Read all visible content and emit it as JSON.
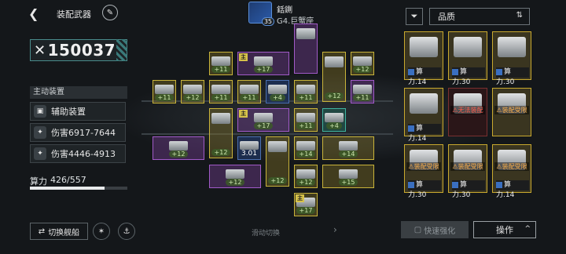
{
  "header": {
    "back_icon": "back-arrow-icon",
    "title": "装配武器",
    "edit_icon": "pencil-icon"
  },
  "ship": {
    "level": "35",
    "name": "銛鍘",
    "class": "G4.巨蟹座"
  },
  "power": {
    "icon": "crossed-swords-icon",
    "value": "150037"
  },
  "left_panel": {
    "section_label": "主动装置",
    "items": [
      {
        "icon": "device-icon",
        "label": "辅助装置"
      },
      {
        "icon": "claw-icon",
        "label": "伤害6917-7644"
      },
      {
        "icon": "claw-icon",
        "label": "伤害4446-4913"
      }
    ],
    "capacity_label": "算力",
    "capacity_value": "426/557",
    "capacity_fraction": 0.765
  },
  "filter": {
    "filter_icon": "filter-icon",
    "sort_label": "品质",
    "sort_icon": "sort-order-icon"
  },
  "grid_slots": [
    {
      "color": "purple",
      "bonus": "",
      "tag": "",
      "id": "s1"
    },
    {
      "color": "gold",
      "bonus": "+11",
      "tag": "",
      "id": "s2"
    },
    {
      "color": "purple",
      "bonus": "+17",
      "tag": "主",
      "id": "s3"
    },
    {
      "color": "gold",
      "bonus": "+12",
      "tag": "",
      "id": "s4"
    },
    {
      "color": "gold",
      "bonus": "+12",
      "tag": "",
      "id": "s5"
    },
    {
      "color": "gold",
      "bonus": "+11",
      "tag": "",
      "id": "s6"
    },
    {
      "color": "gold",
      "bonus": "+12",
      "tag": "",
      "id": "s7"
    },
    {
      "color": "gold",
      "bonus": "+11",
      "tag": "",
      "id": "s8"
    },
    {
      "color": "gold",
      "bonus": "+11",
      "tag": "",
      "id": "s9"
    },
    {
      "color": "blue",
      "bonus": "+4",
      "tag": "",
      "id": "s10"
    },
    {
      "color": "gold",
      "bonus": "+11",
      "tag": "",
      "id": "s11"
    },
    {
      "color": "purple",
      "bonus": "+11",
      "tag": "",
      "id": "s12"
    },
    {
      "color": "gold",
      "bonus": "+12",
      "tag": "",
      "id": "s13"
    },
    {
      "color": "gold",
      "bonus": "+11",
      "tag": "",
      "id": "s14"
    },
    {
      "color": "purple",
      "bonus": "+17",
      "tag": "主",
      "id": "s15"
    },
    {
      "color": "teal",
      "bonus": "+4",
      "tag": "",
      "id": "s16"
    },
    {
      "color": "purple",
      "bonus": "+12",
      "tag": "",
      "id": "s17"
    },
    {
      "color": "blue",
      "bonus": "3.01",
      "tag": "",
      "id": "s18"
    },
    {
      "color": "gold",
      "bonus": "+12",
      "tag": "",
      "id": "s19"
    },
    {
      "color": "gold",
      "bonus": "+14",
      "tag": "",
      "id": "s20"
    },
    {
      "color": "gold",
      "bonus": "+14",
      "tag": "",
      "id": "s21"
    },
    {
      "color": "purple",
      "bonus": "+12",
      "tag": "",
      "id": "s22"
    },
    {
      "color": "gold",
      "bonus": "+12",
      "tag": "",
      "id": "s23"
    },
    {
      "color": "gold",
      "bonus": "+15",
      "tag": "",
      "id": "s24"
    },
    {
      "color": "gold",
      "bonus": "+17",
      "tag": "主",
      "id": "s25"
    }
  ],
  "inventory": [
    {
      "power": "算力.14",
      "warn": "",
      "dark": false
    },
    {
      "power": "算力.30",
      "warn": "",
      "dark": false
    },
    {
      "power": "算力.30",
      "warn": "",
      "dark": false
    },
    {
      "power": "算力.14",
      "warn": "",
      "dark": false
    },
    {
      "power": "",
      "warn": "无法装配",
      "dark": true
    },
    {
      "power": "",
      "warn": "装配受限",
      "dark": false
    },
    {
      "power": "算力.30",
      "warn": "装配受限",
      "dark": false
    },
    {
      "power": "算力.30",
      "warn": "装配受限",
      "dark": false
    },
    {
      "power": "算力.14",
      "warn": "装配受限",
      "dark": false
    }
  ],
  "bottom_bar": {
    "switch_label": "切换舰船",
    "switch_icon": "swap-icon",
    "hint": "滑动切换",
    "hint_arrow": "›",
    "quick_label": "快速强化",
    "action_label": "操作",
    "action_caret": "^"
  }
}
